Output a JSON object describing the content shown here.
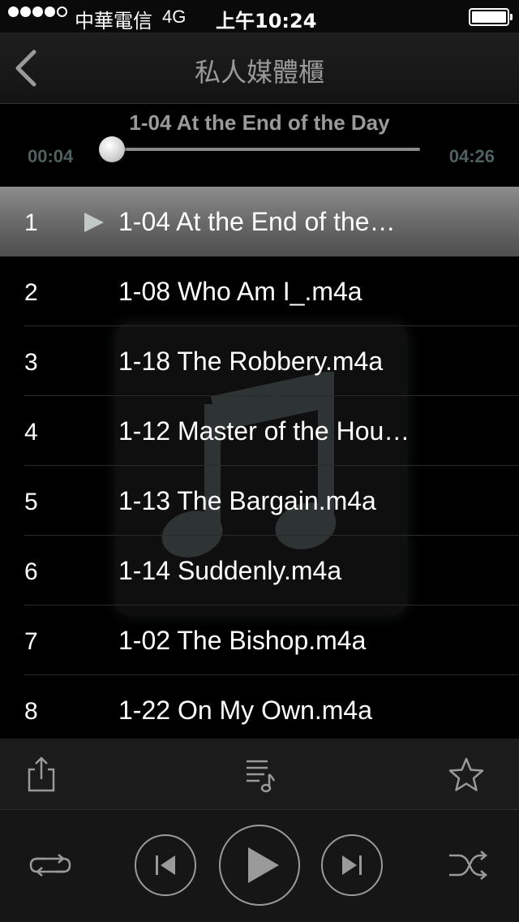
{
  "status_bar": {
    "carrier": "中華電信",
    "network": "4G",
    "time": "上午10:24",
    "signal_bars": 4,
    "signal_total": 5,
    "battery_level": 1.0
  },
  "nav": {
    "title": "私人媒體櫃",
    "back_icon": "chevron-left-icon"
  },
  "now_playing": {
    "title": "1-04 At the End of the Day",
    "elapsed": "00:04",
    "duration": "04:26",
    "progress": 0.015
  },
  "tracks": [
    {
      "number": "1",
      "name": "1-04 At the End of the…",
      "active": true
    },
    {
      "number": "2",
      "name": "1-08 Who Am I_.m4a",
      "active": false
    },
    {
      "number": "3",
      "name": "1-18 The Robbery.m4a",
      "active": false
    },
    {
      "number": "4",
      "name": "1-12 Master of the Hou…",
      "active": false
    },
    {
      "number": "5",
      "name": "1-13 The Bargain.m4a",
      "active": false
    },
    {
      "number": "6",
      "name": "1-14 Suddenly.m4a",
      "active": false
    },
    {
      "number": "7",
      "name": "1-02 The Bishop.m4a",
      "active": false
    },
    {
      "number": "8",
      "name": "1-22 On My Own.m4a",
      "active": false
    }
  ],
  "toolbar": {
    "share_icon": "share-icon",
    "playlist_icon": "playlist-icon",
    "favorite_icon": "star-icon"
  },
  "controls": {
    "repeat_icon": "repeat-icon",
    "previous_icon": "previous-track-icon",
    "play_icon": "play-icon",
    "next_icon": "next-track-icon",
    "shuffle_icon": "shuffle-icon"
  },
  "colors": {
    "background": "#000000",
    "active_row": "#7a7a7a",
    "time_text": "#4f6060",
    "nav_title": "#9a9a9a"
  }
}
